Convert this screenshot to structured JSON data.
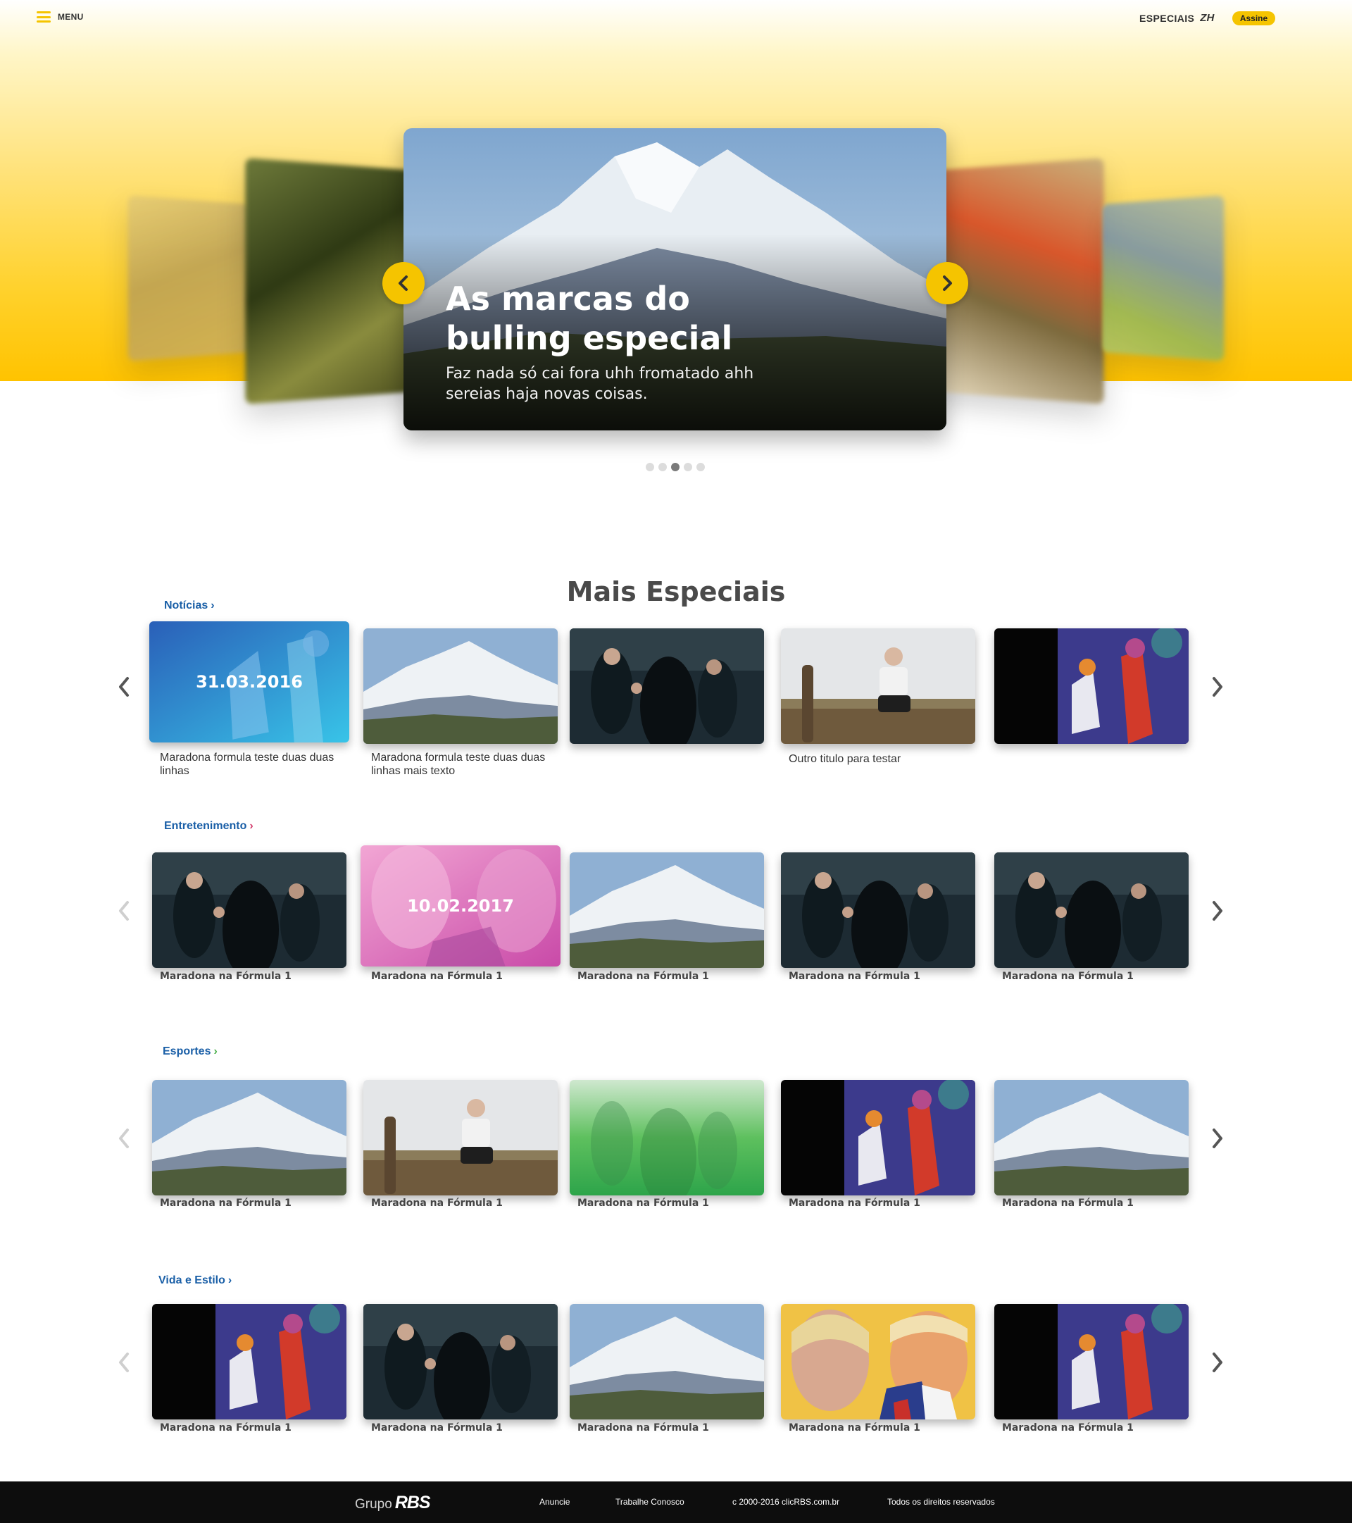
{
  "header": {
    "menu_label": "MENU",
    "brand_text": "ESPECIAIS",
    "brand_logo": "ZH",
    "subscribe_label": "Assine"
  },
  "hero": {
    "title": "As marcas do bulling especial",
    "subtitle": "Faz nada só cai fora uhh fromatado ahh sereias haja novas coisas.",
    "dots": 5,
    "active_dot": 3
  },
  "section": {
    "title": "Mais Especiais"
  },
  "rows": [
    {
      "label": "Notícias",
      "items": [
        {
          "image": "comic-blue",
          "date": "31.03.2016",
          "caption": "Maradona formula teste duas duas linhas"
        },
        {
          "image": "mountain",
          "caption": "Maradona formula teste duas duas linhas mais texto"
        },
        {
          "image": "dark-scene",
          "caption": ""
        },
        {
          "image": "man-field",
          "caption": "Outro titulo para testar"
        },
        {
          "image": "comic-dark",
          "caption": ""
        }
      ]
    },
    {
      "label": "Entretenimento",
      "items": [
        {
          "image": "dark-scene",
          "caption": "Maradona na Fórmula 1"
        },
        {
          "image": "portrait-pink",
          "date": "10.02.2017",
          "caption": "Maradona na Fórmula 1"
        },
        {
          "image": "mountain",
          "caption": "Maradona na Fórmula 1"
        },
        {
          "image": "dark-scene",
          "caption": "Maradona na Fórmula 1"
        },
        {
          "image": "dark-scene",
          "caption": "Maradona na Fórmula 1"
        }
      ]
    },
    {
      "label": "Esportes",
      "items": [
        {
          "image": "mountain",
          "caption": "Maradona na Fórmula 1"
        },
        {
          "image": "man-field",
          "caption": "Maradona na Fórmula 1"
        },
        {
          "image": "green-overlay",
          "caption": "Maradona na Fórmula 1"
        },
        {
          "image": "comic-dark",
          "caption": "Maradona na Fórmula 1"
        },
        {
          "image": "mountain",
          "caption": "Maradona na Fórmula 1"
        }
      ]
    },
    {
      "label": "Vida e Estilo",
      "items": [
        {
          "image": "comic-dark",
          "caption": "Maradona na Fórmula 1"
        },
        {
          "image": "dark-scene",
          "caption": "Maradona na Fórmula 1"
        },
        {
          "image": "mountain",
          "caption": "Maradona na Fórmula 1"
        },
        {
          "image": "portrait-color",
          "caption": "Maradona na Fórmula 1"
        },
        {
          "image": "comic-dark",
          "caption": "Maradona na Fórmula 1"
        }
      ]
    }
  ],
  "footer": {
    "logo_prefix": "Grupo",
    "logo_brand": "RBS",
    "links": [
      "Anuncie",
      "Trabalhe Conosco",
      "c 2000-2016 clicRBS.com.br",
      "Todos os direitos reservados"
    ]
  },
  "colors": {
    "accent": "#f5c400",
    "link_blue": "#1a5fa7",
    "footer_bg": "#0d0d0d"
  }
}
